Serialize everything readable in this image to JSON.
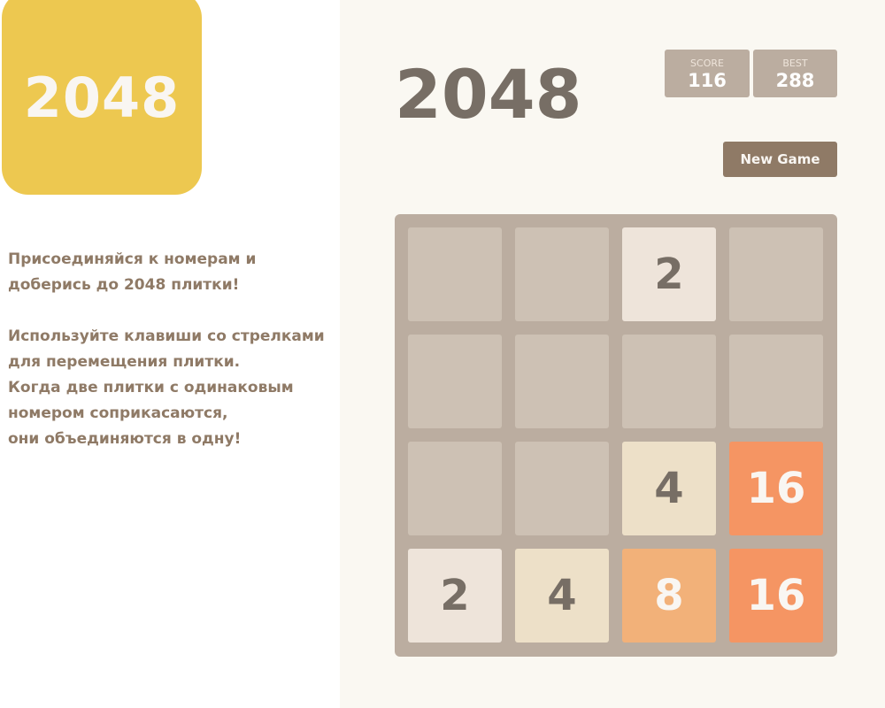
{
  "logo": {
    "text": "2048",
    "color": "#edc850"
  },
  "intro": {
    "lines_1": [
      "Присоединяйся к номерам и",
      "доберись до 2048 плитки!"
    ],
    "lines_2": [
      "Используйте клавиши со стрелками",
      "для перемещения плитки.",
      "Когда две плитки с одинаковым",
      "номером соприкасаются,",
      "они объединяются в одну!"
    ]
  },
  "header": {
    "title": "2048",
    "score": {
      "label": "SCORE",
      "value": "116"
    },
    "best": {
      "label": "BEST",
      "value": "288"
    },
    "new_game_label": "New Game"
  },
  "board": {
    "rows": [
      [
        "",
        "",
        "2",
        ""
      ],
      [
        "",
        "",
        "",
        ""
      ],
      [
        "",
        "",
        "4",
        "16"
      ],
      [
        "2",
        "4",
        "8",
        "16"
      ]
    ]
  },
  "tile_colors": {
    "empty": "#cdc1b4",
    "2": "#eee4da",
    "4": "#ede0c8",
    "8": "#f2b179",
    "16": "#f59563"
  }
}
